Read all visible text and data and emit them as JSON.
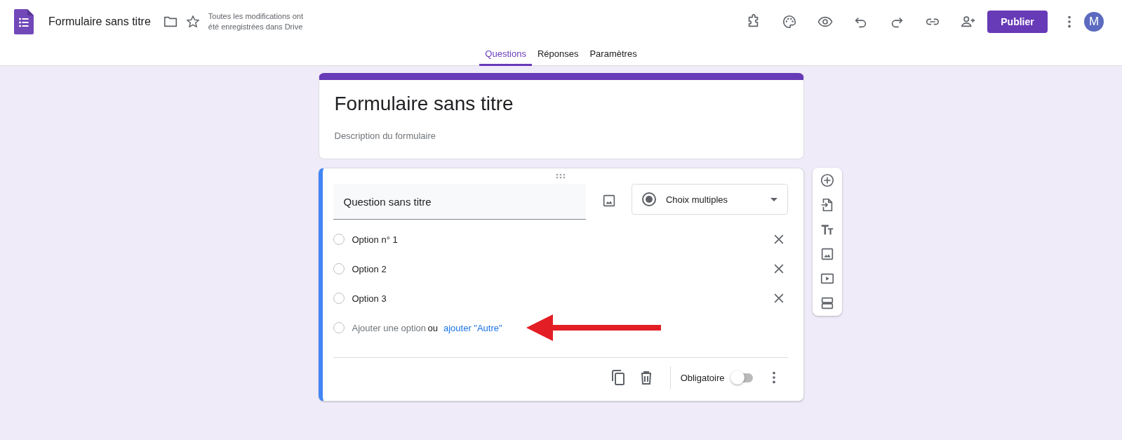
{
  "app": {
    "title": "Formulaire sans titre",
    "save_status": "Toutes les modifications ont été enregistrées dans Drive",
    "publish_button": "Publier",
    "avatar": "M"
  },
  "tabs": [
    {
      "label": "Questions",
      "selected": true
    },
    {
      "label": "Réponses",
      "selected": false
    },
    {
      "label": "Paramètres",
      "selected": false
    }
  ],
  "form_header": {
    "title": "Formulaire sans titre",
    "description": {
      "placeholder": "Description du formulaire"
    }
  },
  "question": {
    "title": "Question sans titre",
    "type": "Choix multiples",
    "options": [
      {
        "label": "Option n° 1",
        "checked": false
      },
      {
        "label": "Option 2",
        "checked": false
      },
      {
        "label": "Option 3",
        "checked": false
      }
    ],
    "add_option": {
      "placeholder": "Ajouter une option",
      "checked": false
    },
    "or": "ou",
    "add_other": "ajouter \"Autre\"",
    "required_label": "Obligatoire",
    "required": false
  }
}
